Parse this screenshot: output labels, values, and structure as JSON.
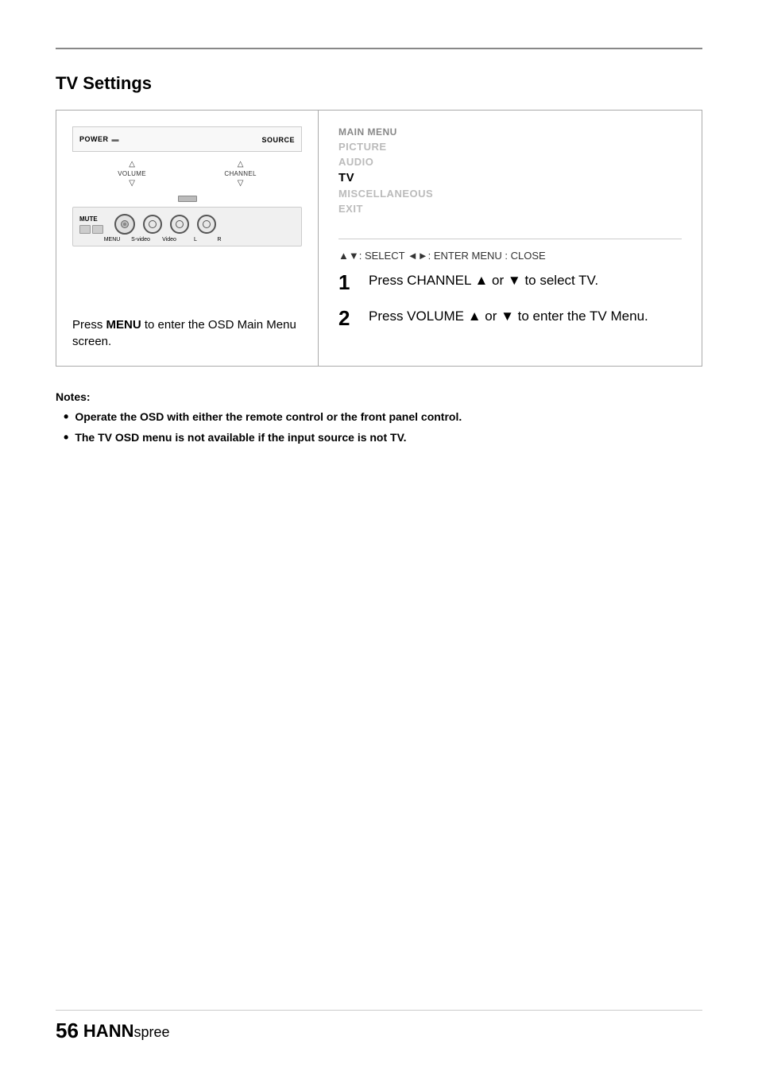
{
  "page": {
    "section_title": "TV Settings",
    "top_rule_visible": true
  },
  "device_diagram": {
    "power_label": "POWER",
    "source_label": "SOURCE",
    "volume_label": "VOLUME",
    "channel_label": "CHANNEL",
    "mute_label": "MUTE",
    "menu_label": "MENU",
    "svideo_label": "S-video",
    "video_label": "Video",
    "l_label": "L",
    "r_label": "R"
  },
  "osd_menu": {
    "items": [
      {
        "label": "MAIN MENU",
        "state": "header"
      },
      {
        "label": "PICTURE",
        "state": "inactive"
      },
      {
        "label": "AUDIO",
        "state": "inactive"
      },
      {
        "label": "TV",
        "state": "active"
      },
      {
        "label": "MISCELLANEOUS",
        "state": "inactive"
      },
      {
        "label": "EXIT",
        "state": "inactive"
      }
    ],
    "nav_hint": "▲▼: SELECT   ◄►: ENTER   MENU : CLOSE"
  },
  "press_menu_instruction": "Press MENU to enter the OSD Main Menu screen.",
  "steps": [
    {
      "number": "1",
      "text": "Press CHANNEL ▲ or ▼ to select TV."
    },
    {
      "number": "2",
      "text": "Press VOLUME ▲ or ▼ to enter the TV Menu."
    }
  ],
  "notes": {
    "title": "Notes:",
    "items": [
      "Operate the OSD with either the remote control or the front panel control.",
      "The TV OSD menu is not available if the input source is not TV."
    ]
  },
  "footer": {
    "page_number": "56",
    "brand_hann": "HANN",
    "brand_spree": "spree"
  }
}
